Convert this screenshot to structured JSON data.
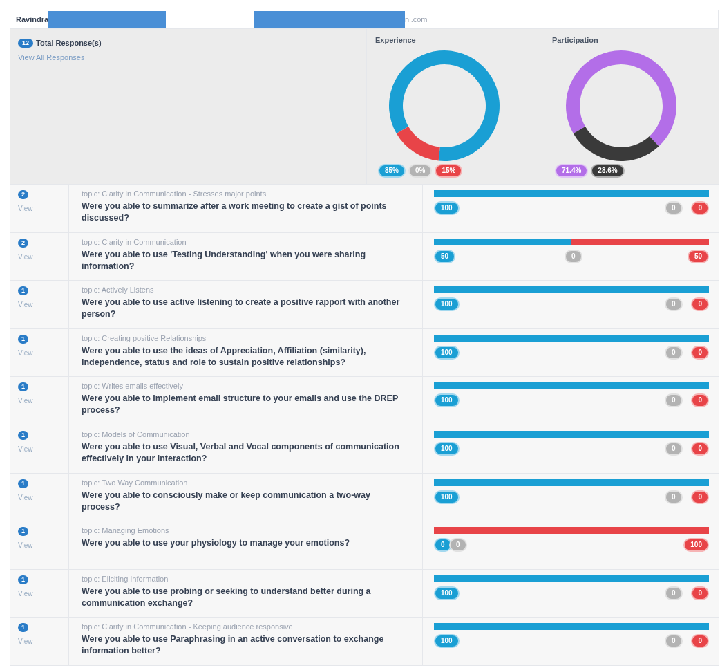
{
  "header": {
    "name": "Ravindra",
    "email_tail": "ni.com"
  },
  "summary": {
    "count": "12",
    "label": "Total Response(s)",
    "link": "View All Responses"
  },
  "charts": [
    {
      "title": "Experience",
      "chart_data": {
        "type": "donut",
        "values": [
          85,
          0,
          15
        ]
      },
      "badges": [
        {
          "text": "85%",
          "color": "#1a9fd4"
        },
        {
          "text": "0%",
          "color": "#b3b3b3"
        },
        {
          "text": "15%",
          "color": "#e84448"
        }
      ]
    },
    {
      "title": "Participation",
      "chart_data": {
        "type": "donut",
        "values": [
          71.4,
          28.6
        ]
      },
      "badges": [
        {
          "text": "71.4%",
          "color": "#b36ee8"
        },
        {
          "text": "28.6%",
          "color": "#3a3a3a"
        }
      ]
    }
  ],
  "rows": [
    {
      "count": "2",
      "link": "View",
      "topic": "topic: Clarity in Communication - Stresses major points",
      "question": "Were you able to summarize after a work meeting to create a gist of points discussed?",
      "level": 1,
      "positive": "100",
      "neutral": "0",
      "negative": "0"
    },
    {
      "count": "2",
      "link": "View",
      "topic": "topic: Clarity in Communication",
      "question": "Were you able to use 'Testing Understanding' when you were sharing information?",
      "level": 0.5,
      "positive": "50",
      "neutral": "0",
      "negative": "50"
    },
    {
      "count": "1",
      "link": "View",
      "topic": "topic: Actively Listens",
      "question": "Were you able to use active listening to create a positive rapport with another person?",
      "level": 1,
      "positive": "100",
      "neutral": "0",
      "negative": "0"
    },
    {
      "count": "1",
      "link": "View",
      "topic": "topic: Creating positive Relationships",
      "question": "Were you able to use the ideas of Appreciation, Affiliation (similarity), independence, status and role to sustain positive relationships?",
      "level": 1,
      "positive": "100",
      "neutral": "0",
      "negative": "0"
    },
    {
      "count": "1",
      "link": "View",
      "topic": "topic: Writes emails effectively",
      "question": "Were you able to implement email structure to your emails and use the DREP process?",
      "level": 1,
      "positive": "100",
      "neutral": "0",
      "negative": "0"
    },
    {
      "count": "1",
      "link": "View",
      "topic": "topic: Models of Communication",
      "question": "Were you able to use Visual, Verbal and Vocal components of communication effectively in your interaction?",
      "level": 1,
      "positive": "100",
      "neutral": "0",
      "negative": "0"
    },
    {
      "count": "1",
      "link": "View",
      "topic": "topic: Two Way Communication",
      "question": "Were you able to consciously make or keep communication a two-way process?",
      "level": 1,
      "positive": "100",
      "neutral": "0",
      "negative": "0"
    },
    {
      "count": "1",
      "link": "View",
      "topic": "topic: Managing Emotions",
      "question": "Were you able to use your physiology to manage your emotions?",
      "level": 0,
      "positive": "0",
      "neutral": "0",
      "negative": "100"
    },
    {
      "count": "1",
      "link": "View",
      "topic": "topic: Eliciting Information",
      "question": "Were you able to use probing or seeking to understand better during a communication exchange?",
      "level": 1,
      "positive": "100",
      "neutral": "0",
      "negative": "0"
    },
    {
      "count": "1",
      "link": "View",
      "topic": "topic: Clarity in Communication - Keeping audience responsive",
      "question": "Were you able to use Paraphrasing in an active conversation to exchange information better?",
      "level": 1,
      "positive": "100",
      "neutral": "0",
      "negative": "0"
    }
  ]
}
